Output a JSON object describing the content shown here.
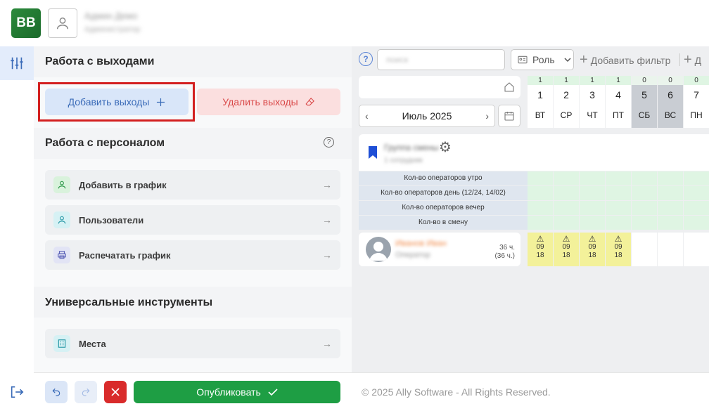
{
  "app": {
    "logo_text": "BB",
    "user_name": "Админ Демо",
    "user_role": "Администратор"
  },
  "panel": {
    "shifts_section": {
      "title": "Работа с выходами",
      "add_label": "Добавить выходы",
      "delete_label": "Удалить выходы"
    },
    "staff_section": {
      "title": "Работа с персоналом",
      "items": [
        {
          "label": "Добавить в график",
          "icon": "user-icon",
          "color": "#d9f2dc"
        },
        {
          "label": "Пользователи",
          "icon": "user-icon",
          "color": "#d6f1f4"
        },
        {
          "label": "Распечатать график",
          "icon": "printer-icon",
          "color": "#e2e4f5"
        }
      ]
    },
    "tools_section": {
      "title": "Универсальные инструменты",
      "items": [
        {
          "label": "Места",
          "icon": "building-icon",
          "color": "#d6f1f4"
        }
      ]
    }
  },
  "bottom": {
    "publish_label": "Опубликовать",
    "copyright": "© 2025 Ally Software - All Rights Reserved."
  },
  "schedule": {
    "search_placeholder": "поиск",
    "role_label": "Роль",
    "add_filter_label": "Добавить фильтр",
    "add_filter_label_2": "Д",
    "month_label": "Июль 2025",
    "days": [
      {
        "count": "1",
        "num": "1",
        "name": "ВТ",
        "weekend": false
      },
      {
        "count": "1",
        "num": "2",
        "name": "СР",
        "weekend": false
      },
      {
        "count": "1",
        "num": "3",
        "name": "ЧТ",
        "weekend": false
      },
      {
        "count": "1",
        "num": "4",
        "name": "ПТ",
        "weekend": false
      },
      {
        "count": "0",
        "num": "5",
        "name": "СБ",
        "weekend": true
      },
      {
        "count": "0",
        "num": "6",
        "name": "ВС",
        "weekend": true
      },
      {
        "count": "0",
        "num": "7",
        "name": "ПН",
        "weekend": false
      }
    ],
    "group": {
      "name": "Группа смены",
      "subtitle": "1 сотрудник"
    },
    "metrics": [
      "Кол-во операторов утро",
      "Кол-во операторов день (12/24, 14/02)",
      "Кол-во операторов вечер",
      "Кол-во в смену"
    ],
    "employee": {
      "name": "Иванов Иван",
      "position": "Оператор",
      "hours": "36 ч.",
      "hours_sub": "(36 ч.)"
    },
    "shifts": [
      {
        "warn": "⚠",
        "start": "09",
        "end": "18"
      },
      {
        "warn": "⚠",
        "start": "09",
        "end": "18"
      },
      {
        "warn": "⚠",
        "start": "09",
        "end": "18"
      },
      {
        "warn": "⚠",
        "start": "09",
        "end": "18"
      }
    ]
  }
}
